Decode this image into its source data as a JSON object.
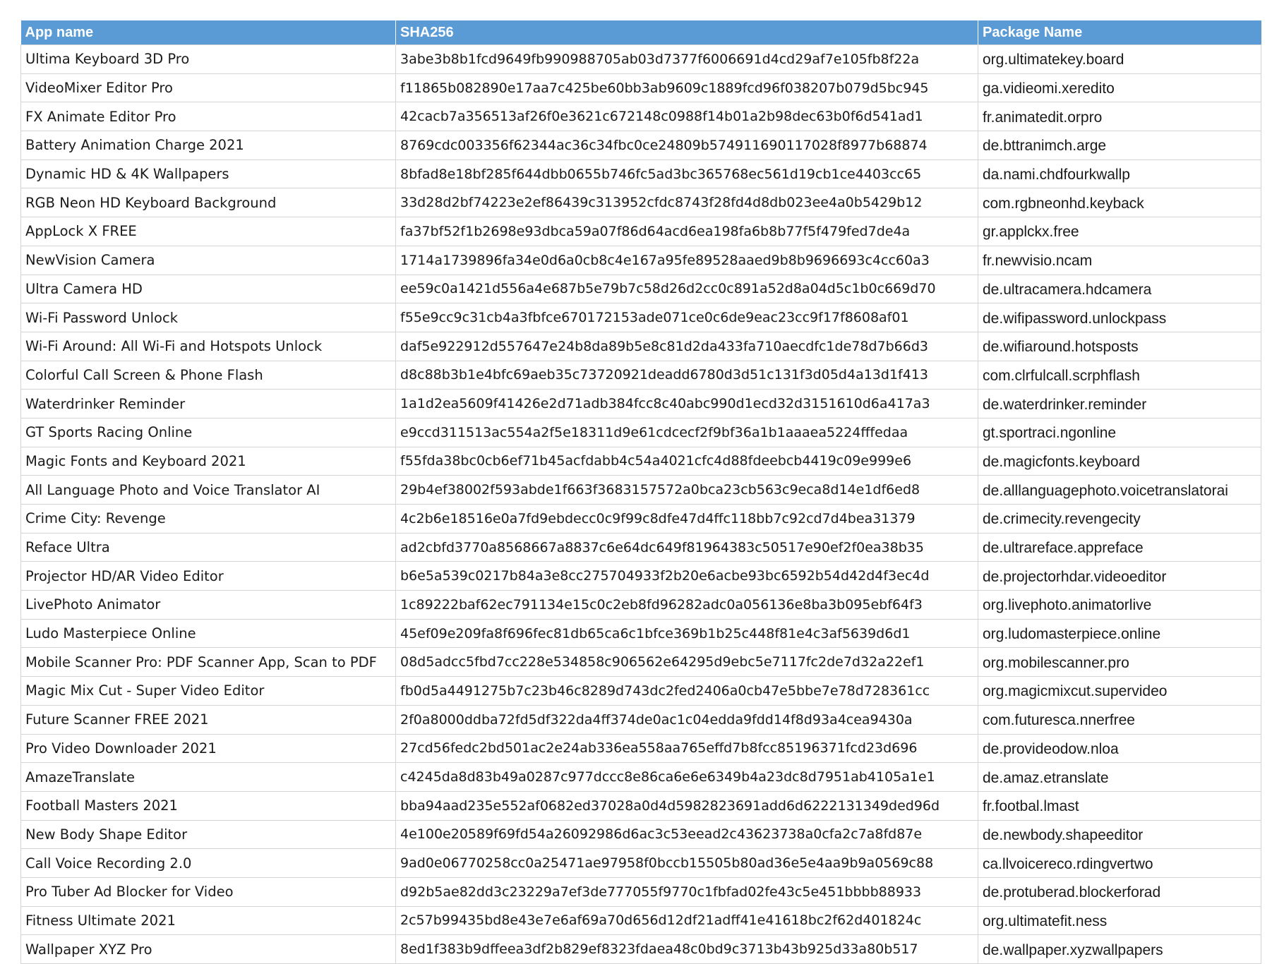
{
  "table": {
    "headers": [
      "App name",
      "SHA256",
      "Package Name"
    ],
    "rows": [
      [
        "Ultima Keyboard 3D Pro",
        "3abe3b8b1fcd9649fb990988705ab03d7377f6006691d4cd29af7e105fb8f22a",
        "org.ultimatekey.board"
      ],
      [
        "VideoMixer Editor Pro",
        "f11865b082890e17aa7c425be60bb3ab9609c1889fcd96f038207b079d5bc945",
        "ga.vidieomi.xeredito"
      ],
      [
        "FX Animate Editor Pro",
        "42cacb7a356513af26f0e3621c672148c0988f14b01a2b98dec63b0f6d541ad1",
        "fr.animatedit.orpro"
      ],
      [
        "Battery Animation Charge 2021",
        "8769cdc003356f62344ac36c34fbc0ce24809b574911690117028f8977b68874",
        "de.bttranimch.arge"
      ],
      [
        "Dynamic HD & 4K Wallpapers",
        "8bfad8e18bf285f644dbb0655b746fc5ad3bc365768ec561d19cb1ce4403cc65",
        "da.nami.chdfourkwallp"
      ],
      [
        "RGB Neon HD Keyboard Background",
        "33d28d2bf74223e2ef86439c313952cfdc8743f28fd4d8db023ee4a0b5429b12",
        "com.rgbneonhd.keyback"
      ],
      [
        "AppLock X FREE",
        "fa37bf52f1b2698e93dbca59a07f86d64acd6ea198fa6b8b77f5f479fed7de4a",
        "gr.applckx.free"
      ],
      [
        "NewVision Camera",
        "1714a1739896fa34e0d6a0cb8c4e167a95fe89528aaed9b8b9696693c4cc60a3",
        "fr.newvisio.ncam"
      ],
      [
        "Ultra Camera HD",
        "ee59c0a1421d556a4e687b5e79b7c58d26d2cc0c891a52d8a04d5c1b0c669d70",
        "de.ultracamera.hdcamera"
      ],
      [
        "Wi-Fi Password Unlock",
        "f55e9cc9c31cb4a3fbfce670172153ade071ce0c6de9eac23cc9f17f8608af01",
        "de.wifipassword.unlockpass"
      ],
      [
        "Wi-Fi Around: All Wi-Fi and Hotspots Unlock",
        "daf5e922912d557647e24b8da89b5e8c81d2da433fa710aecdfc1de78d7b66d3",
        "de.wifiaround.hotsposts"
      ],
      [
        "Colorful Call Screen & Phone Flash",
        "d8c88b3b1e4bfc69aeb35c73720921deadd6780d3d51c131f3d05d4a13d1f413",
        "com.clrfulcall.scrphflash"
      ],
      [
        "Waterdrinker Reminder",
        "1a1d2ea5609f41426e2d71adb384fcc8c40abc990d1ecd32d3151610d6a417a3",
        "de.waterdrinker.reminder"
      ],
      [
        "GT Sports Racing Online",
        "e9ccd311513ac554a2f5e18311d9e61cdcecf2f9bf36a1b1aaaea5224fffedaa",
        "gt.sportraci.ngonline"
      ],
      [
        "Magic Fonts and Keyboard 2021",
        "f55fda38bc0cb6ef71b45acfdabb4c54a4021cfc4d88fdeebcb4419c09e999e6",
        "de.magicfonts.keyboard"
      ],
      [
        "All Language Photo and Voice Translator AI",
        "29b4ef38002f593abde1f663f3683157572a0bca23cb563c9eca8d14e1df6ed8",
        "de.alllanguagephoto.voicetranslatorai"
      ],
      [
        "Crime City: Revenge",
        "4c2b6e18516e0a7fd9ebdecc0c9f99c8dfe47d4ffc118bb7c92cd7d4bea31379",
        "de.crimecity.revengecity"
      ],
      [
        "Reface Ultra",
        "ad2cbfd3770a8568667a8837c6e64dc649f81964383c50517e90ef2f0ea38b35",
        "de.ultrareface.appreface"
      ],
      [
        "Projector HD/AR Video Editor",
        "b6e5a539c0217b84a3e8cc275704933f2b20e6acbe93bc6592b54d42d4f3ec4d",
        "de.projectorhdar.videoeditor"
      ],
      [
        "LivePhoto Animator",
        "1c89222baf62ec791134e15c0c2eb8fd96282adc0a056136e8ba3b095ebf64f3",
        "org.livephoto.animatorlive"
      ],
      [
        "Ludo Masterpiece Online",
        "45ef09e209fa8f696fec81db65ca6c1bfce369b1b25c448f81e4c3af5639d6d1",
        "org.ludomasterpiece.online"
      ],
      [
        "Mobile Scanner Pro: PDF Scanner App, Scan to PDF",
        "08d5adcc5fbd7cc228e534858c906562e64295d9ebc5e7117fc2de7d32a22ef1",
        "org.mobilescanner.pro"
      ],
      [
        "Magic Mix Cut - Super Video Editor",
        "fb0d5a4491275b7c23b46c8289d743dc2fed2406a0cb47e5bbe7e78d728361cc",
        "org.magicmixcut.supervideo"
      ],
      [
        "Future Scanner FREE 2021",
        "2f0a8000ddba72fd5df322da4ff374de0ac1c04edda9fdd14f8d93a4cea9430a",
        "com.futuresca.nnerfree"
      ],
      [
        "Pro Video Downloader 2021",
        "27cd56fedc2bd501ac2e24ab336ea558aa765effd7b8fcc85196371fcd23d696",
        "de.provideodow.nloa"
      ],
      [
        "AmazeTranslate",
        "c4245da8d83b49a0287c977dccc8e86ca6e6e6349b4a23dc8d7951ab4105a1e1",
        "de.amaz.etranslate"
      ],
      [
        "Football Masters 2021",
        "bba94aad235e552af0682ed37028a0d4d5982823691add6d6222131349ded96d",
        "fr.footbal.lmast"
      ],
      [
        "New Body Shape Editor",
        "4e100e20589f69fd54a26092986d6ac3c53eead2c43623738a0cfa2c7a8fd87e",
        "de.newbody.shapeeditor"
      ],
      [
        "Call Voice Recording 2.0",
        "9ad0e06770258cc0a25471ae97958f0bccb15505b80ad36e5e4aa9b9a0569c88",
        "ca.llvoicereco.rdingvertwo"
      ],
      [
        "Pro Tuber Ad Blocker for Video",
        "d92b5ae82dd3c23229a7ef3de777055f9770c1fbfad02fe43c5e451bbbb88933",
        "de.protuberad.blockerforad"
      ],
      [
        "Fitness Ultimate 2021",
        "2c57b99435bd8e43e7e6af69a70d656d12df21adff41e41618bc2f62d401824c",
        "org.ultimatefit.ness"
      ],
      [
        "Wallpaper XYZ Pro",
        "8ed1f383b9dffeea3df2b829ef8323fdaea48c0bd9c3713b43b925d33a80b517",
        "de.wallpaper.xyzwallpapers"
      ]
    ]
  }
}
